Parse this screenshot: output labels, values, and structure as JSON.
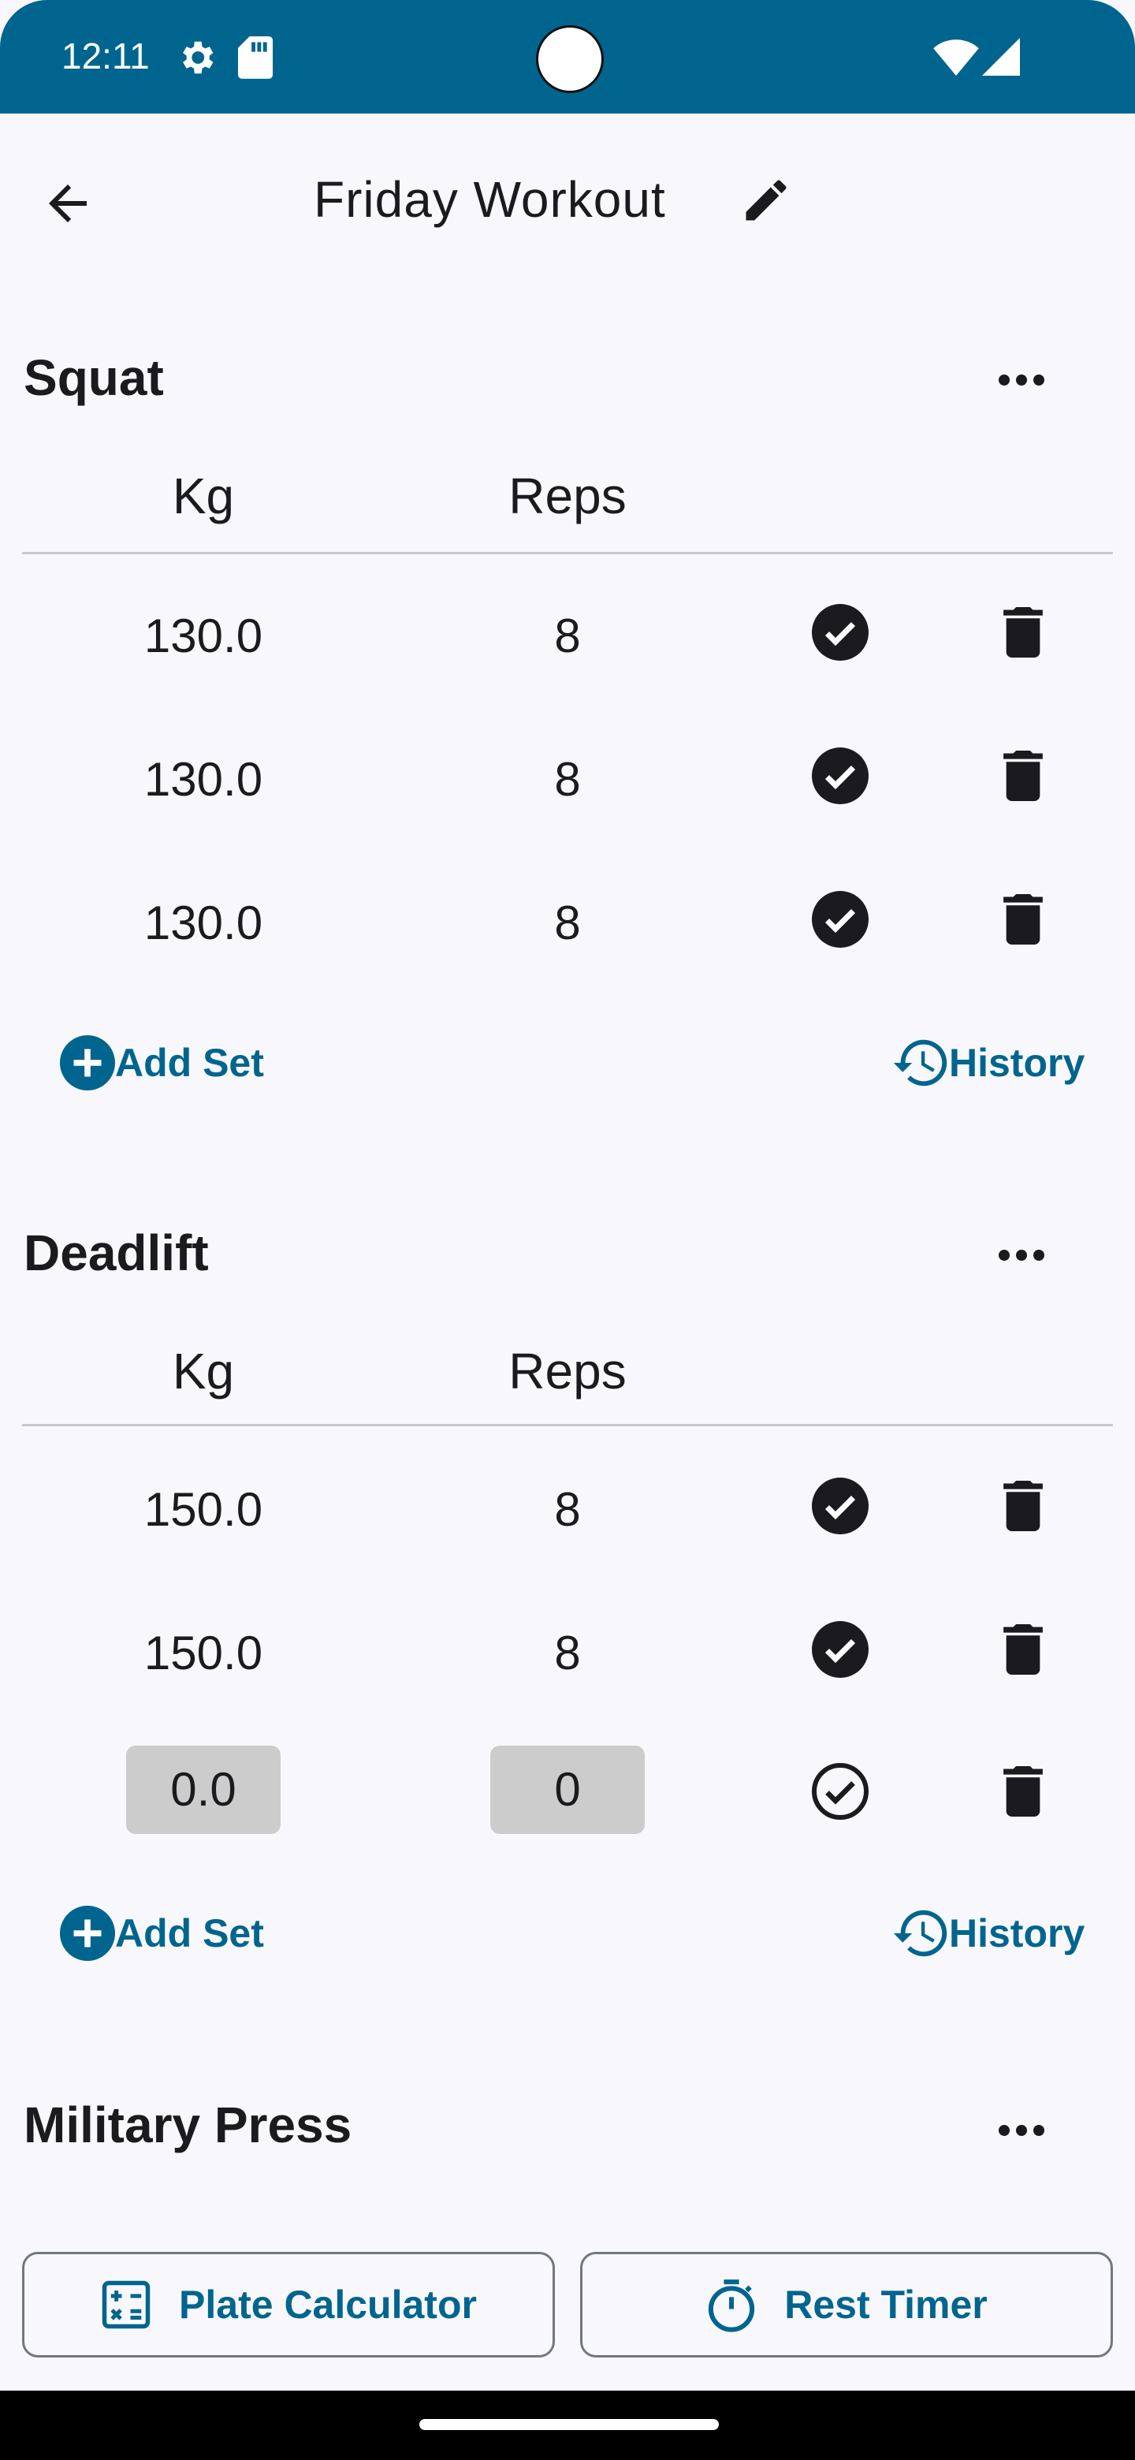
{
  "status_bar": {
    "time": "12:11"
  },
  "header": {
    "title": "Friday Workout"
  },
  "columns": {
    "weight": "Kg",
    "reps": "Reps"
  },
  "exercises": [
    {
      "name": "Squat",
      "sets": [
        {
          "weight": "130.0",
          "reps": "8",
          "done": true
        },
        {
          "weight": "130.0",
          "reps": "8",
          "done": true
        },
        {
          "weight": "130.0",
          "reps": "8",
          "done": true
        }
      ]
    },
    {
      "name": "Deadlift",
      "sets": [
        {
          "weight": "150.0",
          "reps": "8",
          "done": true
        },
        {
          "weight": "150.0",
          "reps": "8",
          "done": true
        },
        {
          "weight": "0.0",
          "reps": "0",
          "done": false
        }
      ]
    },
    {
      "name": "Military Press",
      "sets": []
    }
  ],
  "actions": {
    "add_set": "Add Set",
    "history": "History"
  },
  "bottom": {
    "plate_calculator": "Plate Calculator",
    "rest_timer": "Rest Timer"
  },
  "colors": {
    "primary": "#00658e",
    "background": "#f8f8fc",
    "input_fill": "#cccccc"
  }
}
